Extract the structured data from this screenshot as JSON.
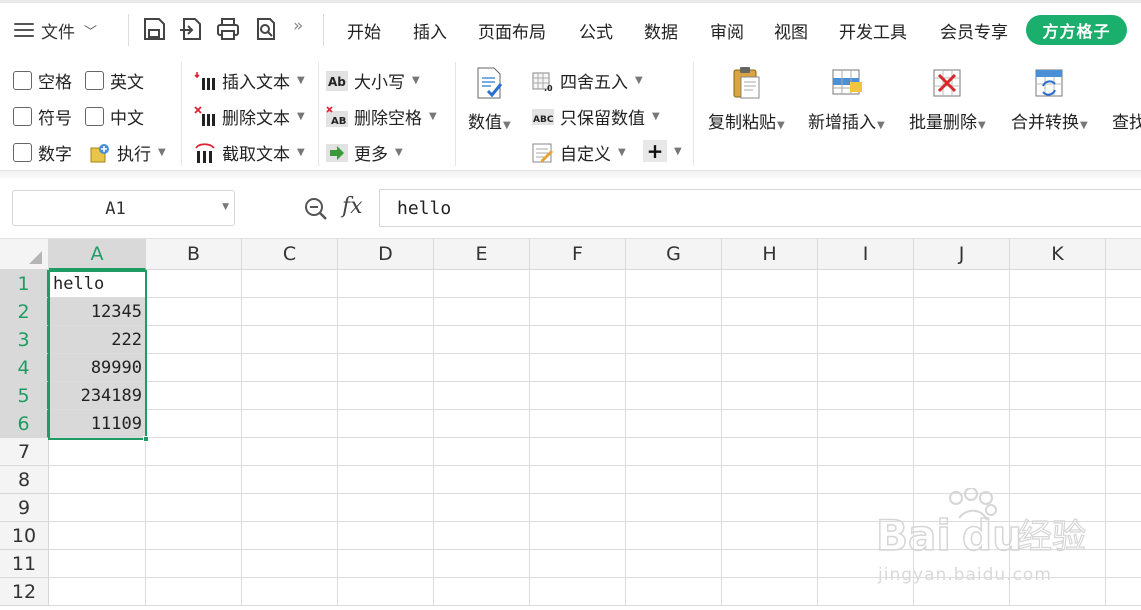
{
  "menubar": {
    "file_label": "文件",
    "quick_access": [
      "save-icon",
      "export-icon",
      "print-icon",
      "print-preview-icon"
    ],
    "tabs": [
      "开始",
      "插入",
      "页面布局",
      "公式",
      "数据",
      "审阅",
      "视图",
      "开发工具",
      "会员专享"
    ],
    "member_button": "方方格子",
    "member_color": "#1aaf6c"
  },
  "ribbon": {
    "checkboxes": {
      "space": "空格",
      "english": "英文",
      "symbol": "符号",
      "chinese": "中文",
      "digit": "数字"
    },
    "execute": "执行",
    "insert_text": "插入文本",
    "delete_text": "删除文本",
    "extract_text": "截取文本",
    "case": "大小写",
    "delete_space": "删除空格",
    "more": "更多",
    "numeric": "数值",
    "round": "四舍五入",
    "keep_values": "只保留数值",
    "custom": "自定义",
    "copy_paste": "复制粘贴",
    "add_insert": "新增插入",
    "batch_delete": "批量删除",
    "merge_convert": "合并转换",
    "find": "查找"
  },
  "formula_bar": {
    "cell_ref": "A1",
    "fx_label": "fx",
    "content": "hello"
  },
  "sheet": {
    "columns": [
      "A",
      "B",
      "C",
      "D",
      "E",
      "F",
      "G",
      "H",
      "I",
      "J",
      "K"
    ],
    "rows": [
      "1",
      "2",
      "3",
      "4",
      "5",
      "6",
      "7",
      "8",
      "9",
      "10",
      "11",
      "12"
    ],
    "a_values": [
      "hello",
      "12345",
      "222",
      "89990",
      "234189",
      "11109"
    ],
    "selection": "A1:A6",
    "accent": "#1f9c63"
  },
  "watermark": {
    "brand": "Bai",
    "brand2": "du",
    "suffix": "经验",
    "url": "jingyan.baidu.com"
  }
}
